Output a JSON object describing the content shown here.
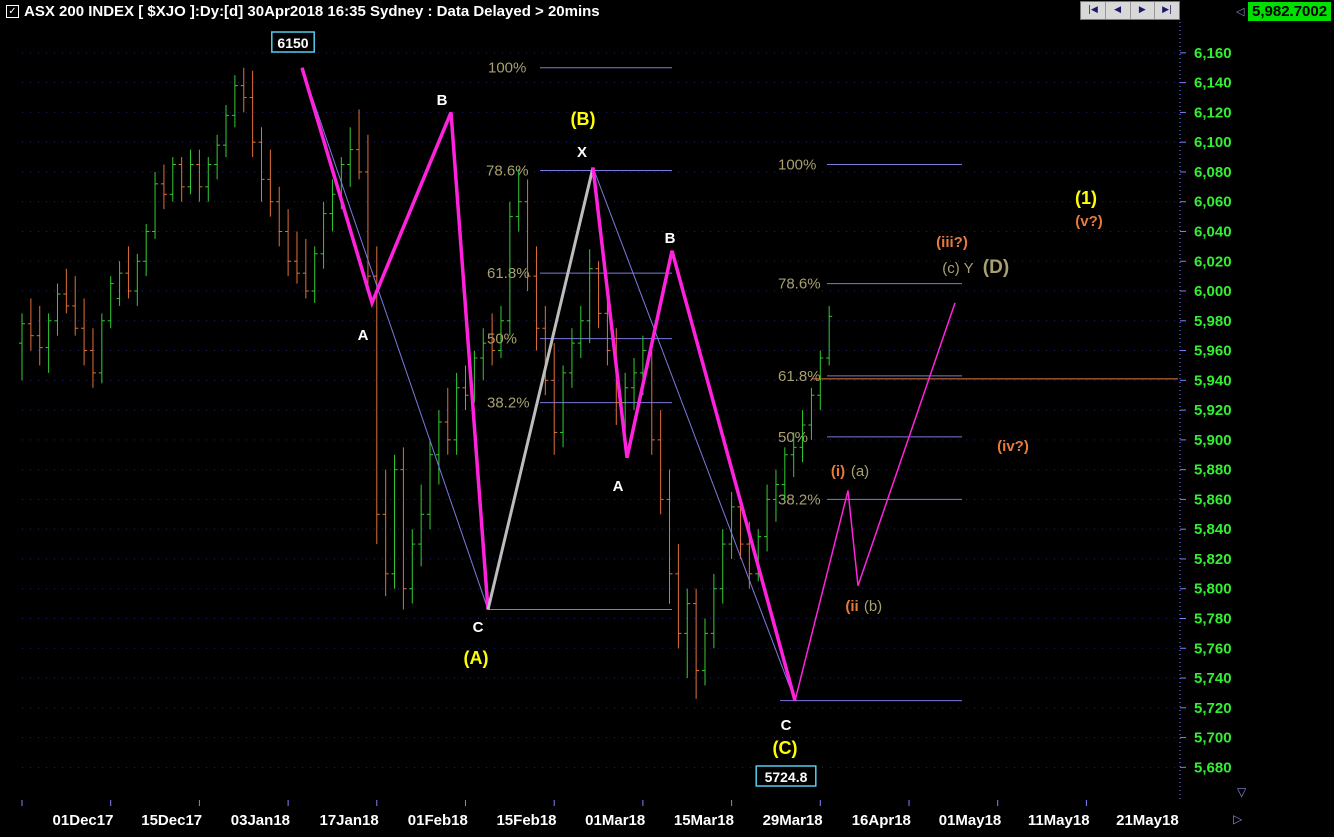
{
  "header": {
    "title": "ASX 200 INDEX [ $XJO ]:Dy:[d]  30Apr2018 16:35 Sydney : Data Delayed > 20mins",
    "last_price": "5,982.7002",
    "checkbox_mark": "✓",
    "nav": [
      "|◀",
      "◀",
      "▶",
      "▶|"
    ],
    "nav_icons": [
      "first-icon",
      "prev-icon",
      "next-icon",
      "last-icon"
    ]
  },
  "chart_data": {
    "type": "ohlc",
    "title": "ASX 200 INDEX [ $XJO ]:Dy:[d]",
    "ylim": [
      5660,
      6170
    ],
    "y_ticks": [
      5680,
      5700,
      5720,
      5740,
      5760,
      5780,
      5800,
      5820,
      5840,
      5860,
      5880,
      5900,
      5920,
      5940,
      5960,
      5980,
      6000,
      6020,
      6040,
      6060,
      6080,
      6100,
      6120,
      6140,
      6160
    ],
    "y_tick_labels": [
      "5,680",
      "5,700",
      "5,720",
      "5,740",
      "5,760",
      "5,780",
      "5,800",
      "5,820",
      "5,840",
      "5,860",
      "5,880",
      "5,900",
      "5,920",
      "5,940",
      "5,960",
      "5,980",
      "6,000",
      "6,020",
      "6,040",
      "6,060",
      "6,080",
      "6,100",
      "6,120",
      "6,140",
      "6,160"
    ],
    "x_tick_labels": [
      "01Dec17",
      "15Dec17",
      "03Jan18",
      "17Jan18",
      "01Feb18",
      "15Feb18",
      "01Mar18",
      "15Mar18",
      "29Mar18",
      "16Apr18",
      "01May18",
      "11May18",
      "21May18"
    ],
    "x_tick_index": [
      0,
      10,
      20,
      30,
      40,
      50,
      60,
      70,
      80,
      90,
      100,
      110,
      120
    ],
    "colors": {
      "up": "#33cc33",
      "down": "#e0703a",
      "wave": "#ff22dd",
      "fib": "#7a7ae0",
      "fib_label": "#a8a070",
      "label_yellow": "#ffff00",
      "label_white": "#ffffff",
      "label_orange": "#e87a3a",
      "box": "#55ccee"
    },
    "bars": [
      [
        5965,
        5985,
        5940,
        5978
      ],
      [
        5978,
        5995,
        5960,
        5970
      ],
      [
        5970,
        5990,
        5950,
        5962
      ],
      [
        5962,
        5985,
        5945,
        5980
      ],
      [
        5980,
        6005,
        5970,
        5998
      ],
      [
        5998,
        6015,
        5985,
        5990
      ],
      [
        5990,
        6010,
        5970,
        5975
      ],
      [
        5975,
        5995,
        5950,
        5960
      ],
      [
        5960,
        5975,
        5935,
        5945
      ],
      [
        5945,
        5985,
        5938,
        5980
      ],
      [
        5980,
        6010,
        5975,
        6005
      ],
      [
        5995,
        6020,
        5990,
        6012
      ],
      [
        6012,
        6030,
        5995,
        6000
      ],
      [
        6000,
        6025,
        5990,
        6020
      ],
      [
        6020,
        6045,
        6010,
        6040
      ],
      [
        6040,
        6080,
        6035,
        6072
      ],
      [
        6072,
        6085,
        6055,
        6065
      ],
      [
        6065,
        6090,
        6060,
        6085
      ],
      [
        6085,
        6090,
        6060,
        6070
      ],
      [
        6070,
        6095,
        6065,
        6085
      ],
      [
        6085,
        6095,
        6060,
        6070
      ],
      [
        6070,
        6090,
        6060,
        6085
      ],
      [
        6085,
        6105,
        6075,
        6098
      ],
      [
        6098,
        6125,
        6090,
        6118
      ],
      [
        6118,
        6145,
        6110,
        6138
      ],
      [
        6138,
        6150,
        6120,
        6130
      ],
      [
        6130,
        6148,
        6090,
        6100
      ],
      [
        6100,
        6110,
        6060,
        6075
      ],
      [
        6075,
        6095,
        6050,
        6060
      ],
      [
        6060,
        6070,
        6030,
        6040
      ],
      [
        6040,
        6055,
        6010,
        6020
      ],
      [
        6020,
        6040,
        6005,
        6012
      ],
      [
        6012,
        6035,
        5995,
        6000
      ],
      [
        6000,
        6030,
        5992,
        6025
      ],
      [
        6025,
        6060,
        6015,
        6052
      ],
      [
        6052,
        6075,
        6040,
        6065
      ],
      [
        6065,
        6090,
        6055,
        6085
      ],
      [
        6085,
        6110,
        6070,
        6095
      ],
      [
        6095,
        6122,
        6075,
        6080
      ],
      [
        6080,
        6105,
        6000,
        6010
      ],
      [
        6010,
        6030,
        5830,
        5850
      ],
      [
        5850,
        5880,
        5795,
        5810
      ],
      [
        5810,
        5890,
        5800,
        5880
      ],
      [
        5880,
        5895,
        5786,
        5800
      ],
      [
        5800,
        5840,
        5790,
        5830
      ],
      [
        5830,
        5870,
        5815,
        5850
      ],
      [
        5850,
        5900,
        5840,
        5890
      ],
      [
        5890,
        5920,
        5870,
        5912
      ],
      [
        5912,
        5935,
        5890,
        5900
      ],
      [
        5900,
        5945,
        5890,
        5935
      ],
      [
        5935,
        5950,
        5920,
        5930
      ],
      [
        5930,
        5960,
        5925,
        5955
      ],
      [
        5955,
        5975,
        5940,
        5965
      ],
      [
        5965,
        5985,
        5950,
        5960
      ],
      [
        5960,
        5990,
        5955,
        5980
      ],
      [
        5980,
        6060,
        5970,
        6050
      ],
      [
        6050,
        6082,
        6040,
        6060
      ],
      [
        6060,
        6075,
        6000,
        6010
      ],
      [
        6010,
        6030,
        5960,
        5975
      ],
      [
        5975,
        5990,
        5930,
        5940
      ],
      [
        5940,
        5965,
        5890,
        5905
      ],
      [
        5905,
        5950,
        5895,
        5945
      ],
      [
        5945,
        5975,
        5935,
        5965
      ],
      [
        5965,
        5990,
        5955,
        5980
      ],
      [
        5980,
        6028,
        5965,
        6015
      ],
      [
        6015,
        6020,
        5975,
        5985
      ],
      [
        5985,
        6000,
        5950,
        5960
      ],
      [
        5960,
        5975,
        5910,
        5925
      ],
      [
        5925,
        5945,
        5905,
        5935
      ],
      [
        5935,
        5955,
        5920,
        5945
      ],
      [
        5945,
        5970,
        5930,
        5960
      ],
      [
        5960,
        5965,
        5890,
        5900
      ],
      [
        5900,
        5920,
        5850,
        5860
      ],
      [
        5860,
        5880,
        5790,
        5810
      ],
      [
        5810,
        5830,
        5760,
        5770
      ],
      [
        5770,
        5800,
        5740,
        5790
      ],
      [
        5790,
        5800,
        5726,
        5745
      ],
      [
        5745,
        5780,
        5735,
        5770
      ],
      [
        5770,
        5810,
        5760,
        5800
      ],
      [
        5800,
        5840,
        5790,
        5830
      ],
      [
        5830,
        5865,
        5820,
        5855
      ],
      [
        5855,
        5860,
        5820,
        5830
      ],
      [
        5830,
        5845,
        5800,
        5810
      ],
      [
        5810,
        5840,
        5805,
        5835
      ],
      [
        5835,
        5870,
        5825,
        5860
      ],
      [
        5860,
        5880,
        5845,
        5870
      ],
      [
        5870,
        5895,
        5860,
        5890
      ],
      [
        5890,
        5905,
        5875,
        5895
      ],
      [
        5895,
        5920,
        5885,
        5910
      ],
      [
        5910,
        5935,
        5900,
        5930
      ],
      [
        5930,
        5960,
        5920,
        5955
      ],
      [
        5955,
        5990,
        5950,
        5983
      ]
    ],
    "fib_levels": [
      {
        "label": "100%",
        "y": 6150
      },
      {
        "label": "78.6%",
        "y": 6081
      },
      {
        "label": "61.8%",
        "y": 6012
      },
      {
        "label": "50%",
        "y": 5968
      },
      {
        "label": "38.2%",
        "y": 5925
      },
      {
        "label": "100%",
        "y": 6085
      },
      {
        "label": "78.6%",
        "y": 6005
      },
      {
        "label": "61.8%",
        "y": 5943
      },
      {
        "label": "50%",
        "y": 5902
      },
      {
        "label": "38.2%",
        "y": 5860
      }
    ],
    "wave_labels": [
      {
        "text": "6150",
        "style": "box"
      },
      {
        "text": "B",
        "style": "white"
      },
      {
        "text": "A",
        "style": "white"
      },
      {
        "text": "C",
        "style": "white"
      },
      {
        "text": "(A)",
        "style": "yellow"
      },
      {
        "text": "(B)",
        "style": "yellow"
      },
      {
        "text": "X",
        "style": "white"
      },
      {
        "text": "B",
        "style": "white"
      },
      {
        "text": "A",
        "style": "white"
      },
      {
        "text": "C",
        "style": "white"
      },
      {
        "text": "(C)",
        "style": "yellow"
      },
      {
        "text": "5724.8",
        "style": "box"
      },
      {
        "text": "(i)",
        "style": "orange"
      },
      {
        "text": "(a)",
        "style": "olive"
      },
      {
        "text": "(ii",
        "style": "orange"
      },
      {
        "text": "(b)",
        "style": "olive"
      },
      {
        "text": "(iii?)",
        "style": "orange"
      },
      {
        "text": "(c) Y",
        "style": "olive"
      },
      {
        "text": "(D)",
        "style": "olive-large"
      },
      {
        "text": "(iv?)",
        "style": "orange"
      },
      {
        "text": "(1)",
        "style": "yellow"
      },
      {
        "text": "(v?)",
        "style": "orange"
      }
    ]
  }
}
